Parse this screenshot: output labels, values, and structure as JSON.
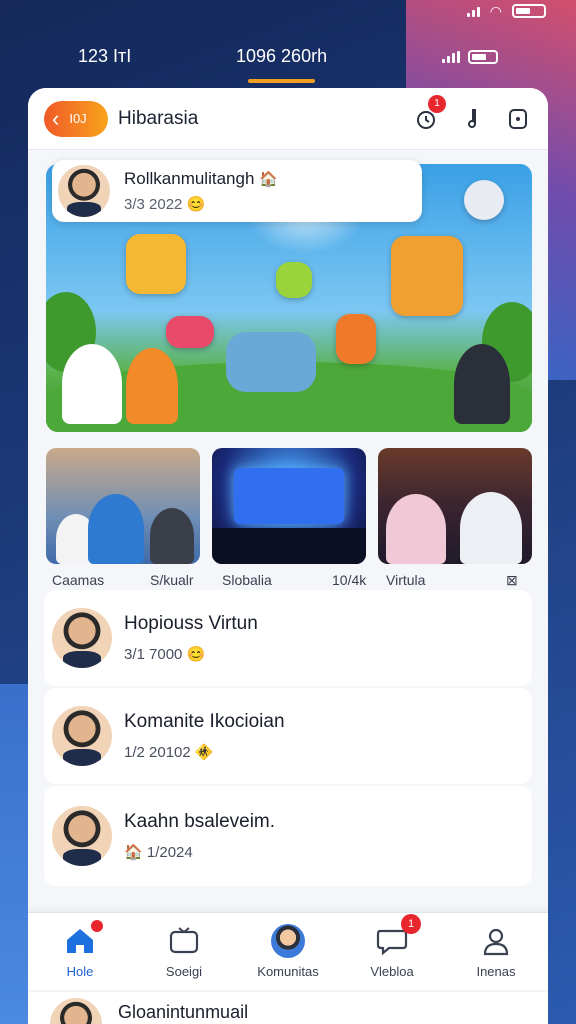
{
  "status_bar": {
    "icons": [
      "signal-icon",
      "wifi-icon",
      "battery-icon"
    ]
  },
  "top_bar": {
    "left_text": "123 IтI",
    "center_text": "1096 260rh"
  },
  "header": {
    "back_badge": "I0J",
    "title": "Hibarasia",
    "notif_count": "1"
  },
  "post": {
    "author": "Rollkanmulitangh",
    "author_emoji": "🏠",
    "date": "3/3 2022",
    "date_emoji": "😊"
  },
  "thumbnails": {
    "labels": [
      "Caamas",
      "S/kualr",
      "Slobalia",
      "10/4k",
      "Virtula",
      "⊠"
    ]
  },
  "list": [
    {
      "name": "Hopiouss Virtun",
      "meta": "3/1 7000",
      "emoji": "😊"
    },
    {
      "name": "Komanite Ikocioian",
      "meta": "1/2 20102",
      "emoji": "🚸"
    },
    {
      "name": "Kaahn bsaleveim.",
      "meta": "1/2024",
      "emoji": "🏠"
    }
  ],
  "bottom_nav": [
    {
      "label": "Hole",
      "icon": "home-icon"
    },
    {
      "label": "Soeigi",
      "icon": "tv-icon"
    },
    {
      "label": "Komunitas",
      "icon": "community-avatar-icon"
    },
    {
      "label": "Vlebloa",
      "icon": "chat-icon",
      "badge": "1"
    },
    {
      "label": "Inenas",
      "icon": "profile-icon"
    }
  ],
  "peek_item": {
    "name": "Gloanintunmuail"
  },
  "colors": {
    "accent": "#1e6fe0",
    "badge": "#e8262e",
    "orange": "#f05a28"
  }
}
